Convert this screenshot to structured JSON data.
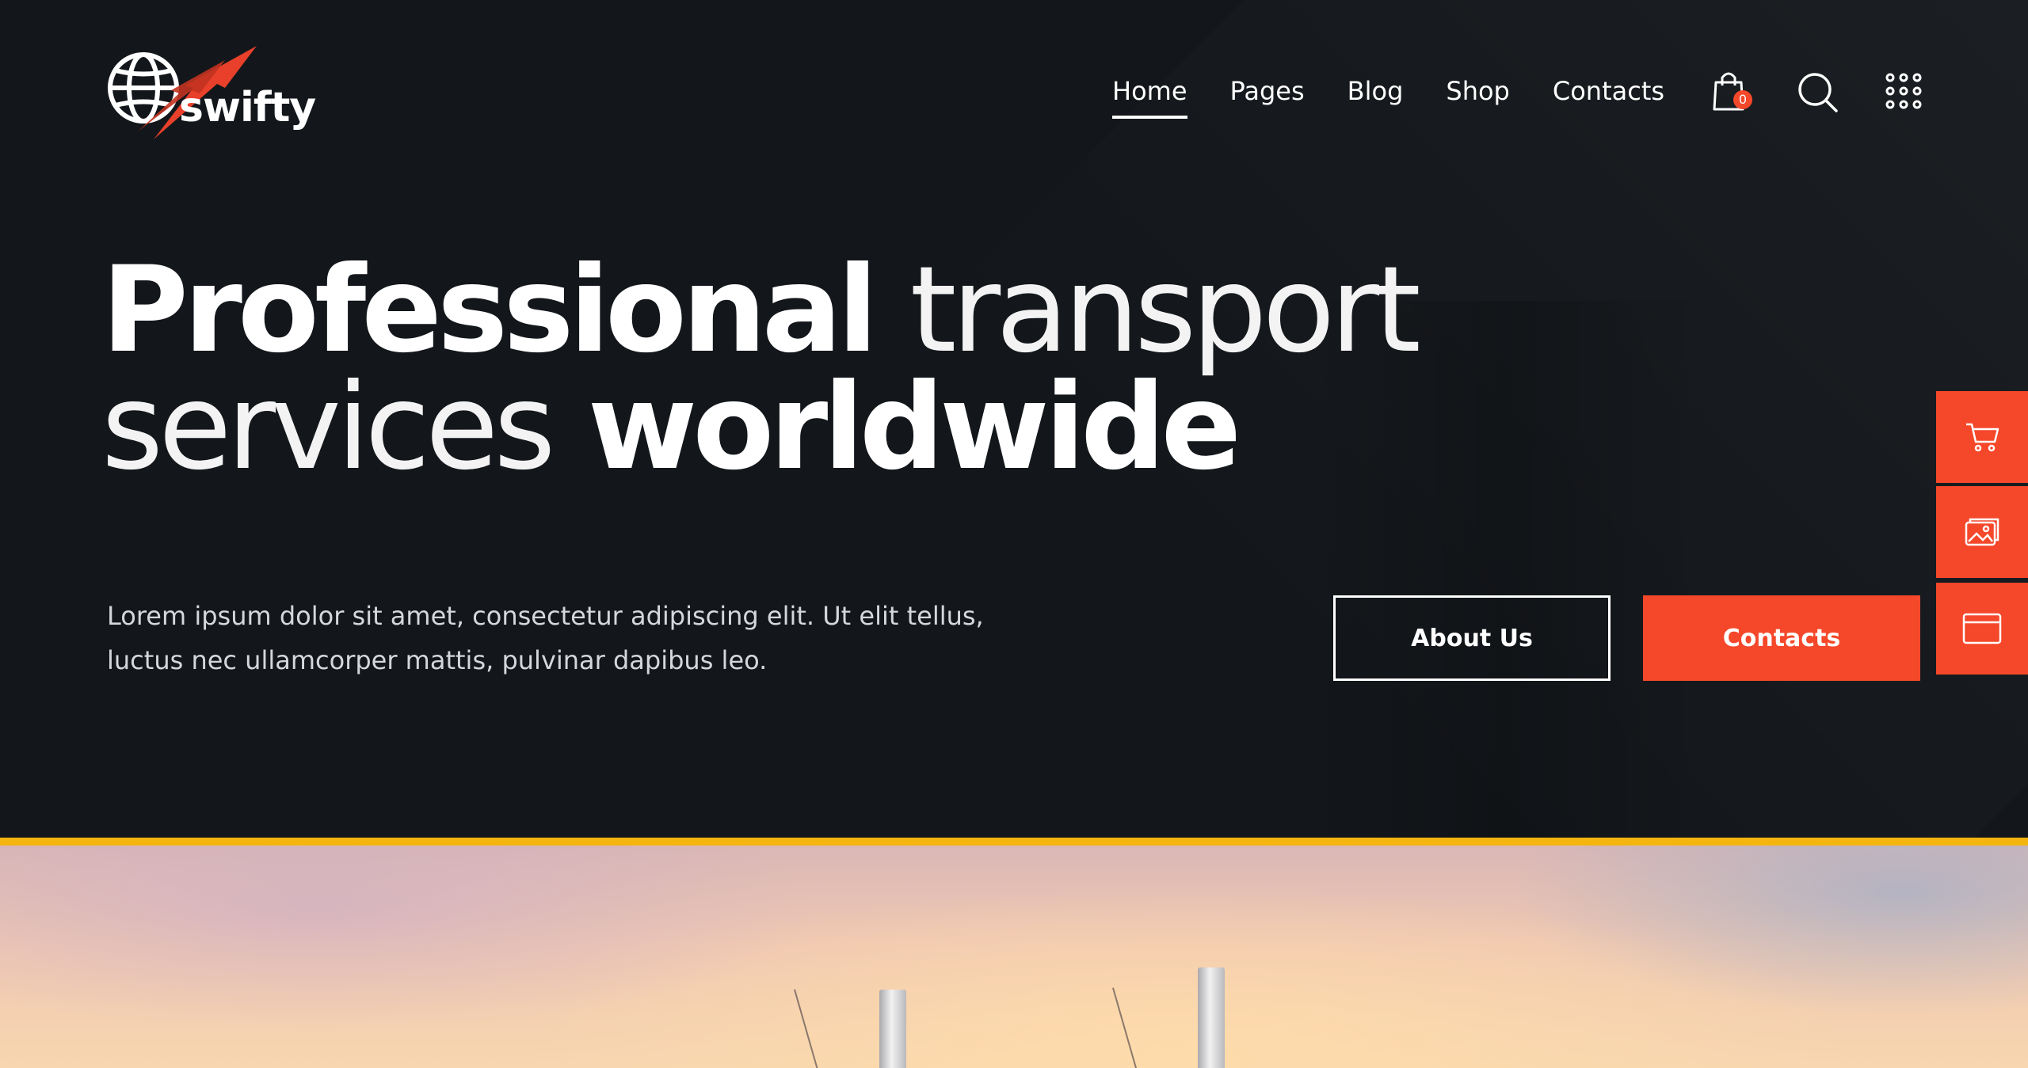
{
  "brand": {
    "name": "swifty",
    "accent_color": "#f5472a",
    "band_color": "#f5b50f"
  },
  "nav": {
    "items": [
      {
        "label": "Home",
        "active": true
      },
      {
        "label": "Pages",
        "active": false
      },
      {
        "label": "Blog",
        "active": false
      },
      {
        "label": "Shop",
        "active": false
      },
      {
        "label": "Contacts",
        "active": false
      }
    ]
  },
  "header_icons": {
    "cart": {
      "icon": "shopping-bag-icon",
      "badge": "0"
    },
    "search": {
      "icon": "search-icon"
    },
    "menu": {
      "icon": "grid-menu-icon"
    }
  },
  "hero": {
    "line1_bold": "Professional",
    "line1_light": "transport",
    "line2_light": "services",
    "line2_bold": "worldwide",
    "lead_line1": "Lorem ipsum dolor sit amet, consectetur adipiscing elit. Ut elit tellus,",
    "lead_line2": "luctus nec ullamcorper mattis, pulvinar dapibus leo.",
    "secondary_button": "About Us",
    "primary_button": "Contacts"
  },
  "side_tabs": [
    {
      "icon": "cart-icon"
    },
    {
      "icon": "gallery-icon"
    },
    {
      "icon": "browser-window-icon"
    }
  ]
}
